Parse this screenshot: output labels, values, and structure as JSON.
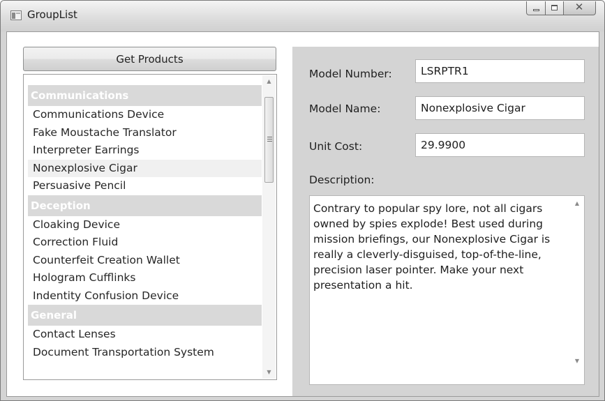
{
  "window": {
    "title": "GroupList",
    "icons": {
      "app": "window-app-icon",
      "minimize": "minimize-icon",
      "maximize": "maximize-icon",
      "close": "close-icon"
    },
    "close_glyph": "✕"
  },
  "toolbar": {
    "get_products_label": "Get Products"
  },
  "product_list": {
    "groups": [
      {
        "header": "Communications",
        "items": [
          "Communications Device",
          "Fake Moustache Translator",
          "Interpreter Earrings",
          "Nonexplosive Cigar",
          "Persuasive Pencil"
        ]
      },
      {
        "header": "Deception",
        "items": [
          "Cloaking Device",
          "Correction Fluid",
          "Counterfeit Creation Wallet",
          "Hologram Cufflinks",
          "Indentity Confusion Device"
        ]
      },
      {
        "header": "General",
        "items": [
          "Contact Lenses",
          "Document Transportation System"
        ]
      }
    ],
    "selected_item": "Nonexplosive Cigar",
    "scroll_up_glyph": "▲",
    "scroll_down_glyph": "▼"
  },
  "details": {
    "model_number_label": "Model Number:",
    "model_number_value": "LSRPTR1",
    "model_name_label": "Model Name:",
    "model_name_value": "Nonexplosive Cigar",
    "unit_cost_label": "Unit Cost:",
    "unit_cost_value": "29.9900",
    "description_label": "Description:",
    "description_value": "Contrary to popular spy lore, not all cigars owned by spies explode! Best used during mission briefings, our Nonexplosive Cigar is really a cleverly-disguised, top-of-the-line, precision laser pointer. Make your next presentation a hit."
  },
  "colors": {
    "group_header_bg": "#d9d9d9",
    "group_header_text": "#ffffff",
    "details_panel_bg": "#d4d4d4",
    "selected_item_bg": "#f0f0f0"
  }
}
